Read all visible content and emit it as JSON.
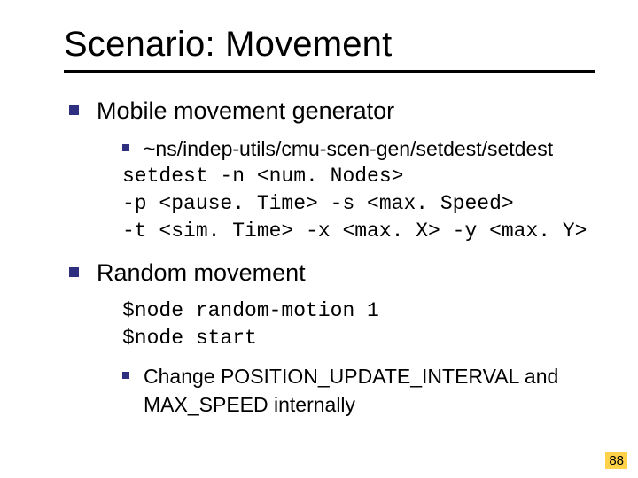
{
  "title": "Scenario: Movement",
  "bullets": {
    "b1": "Mobile movement generator",
    "b1_sub": "~ns/indep-utils/cmu-scen-gen/setdest/setdest",
    "code1_l1": "setdest -n <num. Nodes>",
    "code1_l2": "-p <pause. Time> -s <max. Speed>",
    "code1_l3": "-t <sim. Time> -x <max. X> -y <max. Y>",
    "b2": "Random movement",
    "code2_l1": "$node random-motion 1",
    "code2_l2": "$node start",
    "b2_sub": "Change POSITION_UPDATE_INTERVAL and MAX_SPEED internally"
  },
  "page_number": "88"
}
